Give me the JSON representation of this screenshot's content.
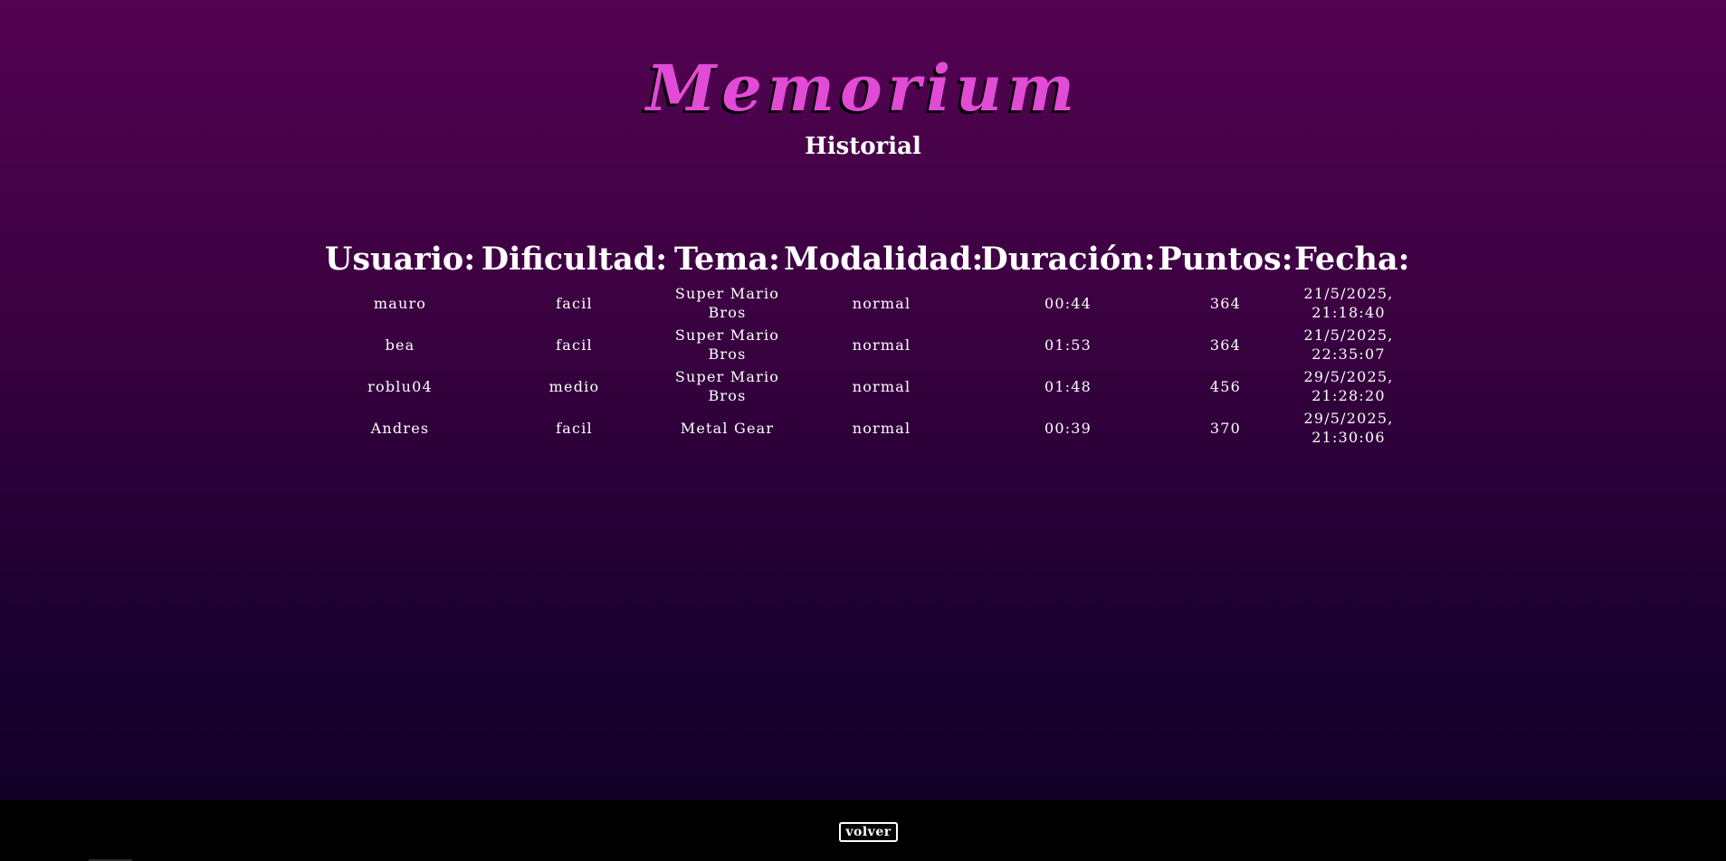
{
  "header": {
    "logo": "Memorium",
    "subtitle": "Historial"
  },
  "table": {
    "headers": [
      "Usuario:",
      "Dificultad:",
      "Tema:",
      "Modalidad:",
      "Duración:",
      "Puntos:",
      "Fecha:"
    ],
    "rows": [
      {
        "usuario": "mauro",
        "dificultad": "facil",
        "tema": "Super Mario Bros",
        "modalidad": "normal",
        "duracion": "00:44",
        "puntos": "364",
        "fecha": "21/5/2025, 21:18:40"
      },
      {
        "usuario": "bea",
        "dificultad": "facil",
        "tema": "Super Mario Bros",
        "modalidad": "normal",
        "duracion": "01:53",
        "puntos": "364",
        "fecha": "21/5/2025, 22:35:07"
      },
      {
        "usuario": "roblu04",
        "dificultad": "medio",
        "tema": "Super Mario Bros",
        "modalidad": "normal",
        "duracion": "01:48",
        "puntos": "456",
        "fecha": "29/5/2025, 21:28:20"
      },
      {
        "usuario": "Andres",
        "dificultad": "facil",
        "tema": "Metal Gear",
        "modalidad": "normal",
        "duracion": "00:39",
        "puntos": "370",
        "fecha": "29/5/2025, 21:30:06"
      }
    ]
  },
  "footer": {
    "back_label": "volver"
  },
  "colors": {
    "background_top": "#540252",
    "background_bottom": "#120028",
    "logo": "#e14bd6",
    "text": "#ffffff",
    "footer": "#000000"
  }
}
